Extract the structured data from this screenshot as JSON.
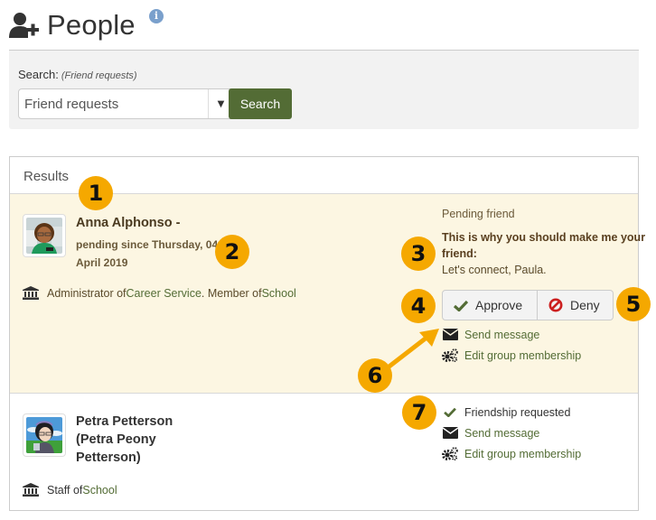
{
  "header": {
    "title": "People",
    "icon": "user-plus-icon",
    "info_icon": "info-icon",
    "info_glyph": "i"
  },
  "search": {
    "label": "Search:",
    "hint": "(Friend requests)",
    "select_value": "Friend requests",
    "caret": "▼",
    "button_label": "Search"
  },
  "results": {
    "title": "Results",
    "rows": [
      {
        "name": "Anna Alphonso",
        "name_suffix": " -",
        "pending_since": "pending since Thursday, 04 April 2019",
        "affiliation": [
          {
            "text": "Administrator of ",
            "link": false
          },
          {
            "text": "Career Service",
            "link": true
          },
          {
            "text": ". Member of ",
            "link": false
          },
          {
            "text": "School",
            "link": true
          }
        ],
        "status_label": "Pending friend",
        "reason_label": "This is why you should make me your friend:",
        "reason_message": "Let's connect, Paula.",
        "approve_label": "Approve",
        "deny_label": "Deny",
        "actions": [
          {
            "icon": "envelope-icon",
            "label": "Send message"
          },
          {
            "icon": "gears-icon",
            "label": "Edit group membership"
          }
        ],
        "highlighted": true
      },
      {
        "name": "Petra Petterson (Petra Peony Petterson)",
        "name_lines": [
          "Petra Petterson",
          "(Petra Peony",
          "Petterson)"
        ],
        "affiliation": [
          {
            "text": "Staff of ",
            "link": false
          },
          {
            "text": "School",
            "link": true
          }
        ],
        "actions": [
          {
            "icon": "check-icon",
            "label": "Friendship requested",
            "link": false
          },
          {
            "icon": "envelope-icon",
            "label": "Send message",
            "link": true
          },
          {
            "icon": "gears-icon",
            "label": "Edit group membership",
            "link": true
          }
        ],
        "highlighted": false
      }
    ]
  },
  "callouts": [
    "1",
    "2",
    "3",
    "4",
    "5",
    "6",
    "7"
  ],
  "colors": {
    "accent": "#536c35",
    "highlight_row": "#fcf6e2",
    "callout": "#f5a800",
    "deny_icon": "#cc1f1f",
    "info": "#7aa0cc"
  }
}
